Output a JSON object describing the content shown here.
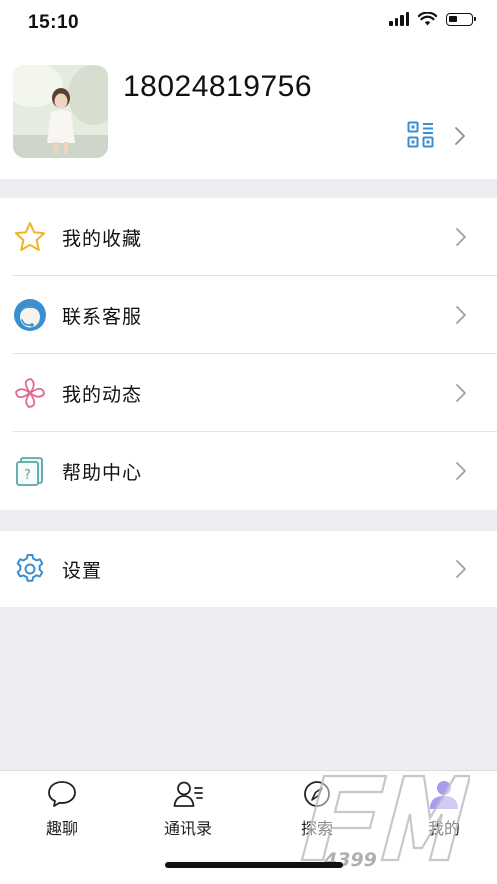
{
  "status_bar": {
    "time": "15:10"
  },
  "profile": {
    "phone": "18024819756"
  },
  "menu": {
    "favorites": "我的收藏",
    "customer_service": "联系客服",
    "my_moments": "我的动态",
    "help_center": "帮助中心",
    "settings": "设置"
  },
  "tabs": {
    "chat": "趣聊",
    "contacts": "通讯录",
    "explore": "探索",
    "me": "我的"
  },
  "watermark": {
    "brand": "FM",
    "number": "4399"
  },
  "colors": {
    "accent_blue": "#3a8fd0",
    "tab_active": "#a99bf0",
    "star": "#f0b429",
    "fan": "#e06b8e",
    "help": "#5aa6a6",
    "background": "#ededf2"
  }
}
